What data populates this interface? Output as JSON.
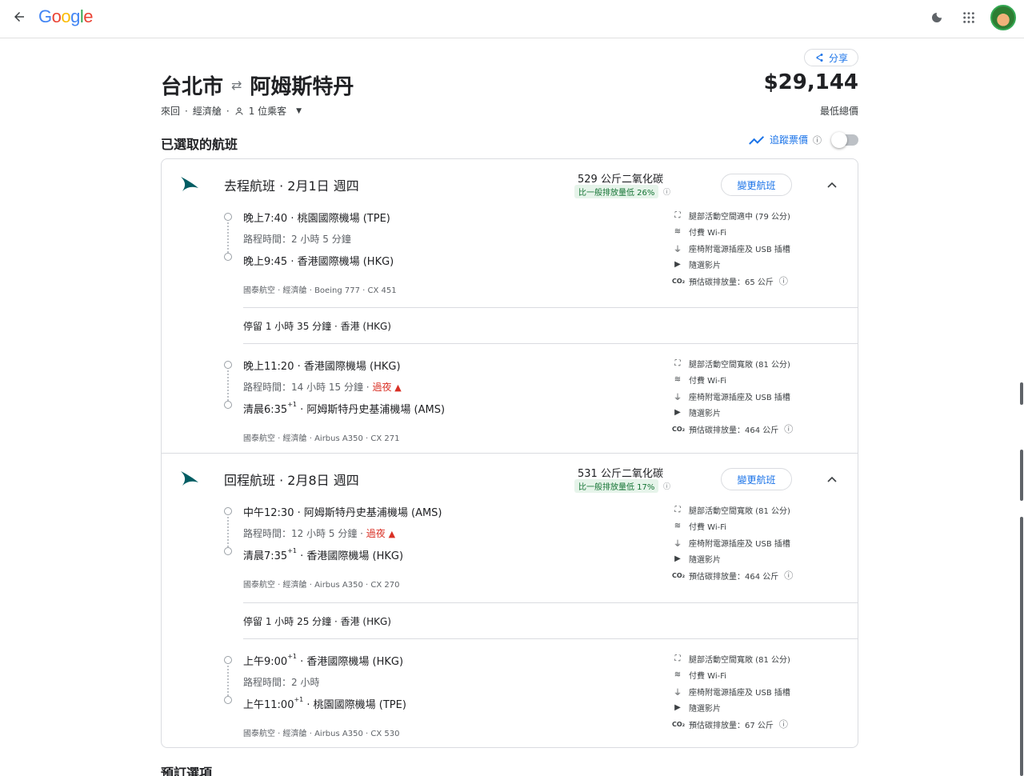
{
  "topbar": {
    "logo_text": "Google",
    "logo_colors": [
      "#4285F4",
      "#EA4335",
      "#FBBC05",
      "#4285F4",
      "#34A853",
      "#EA4335"
    ],
    "icons": [
      "back-arrow-icon",
      "dark-mode-icon",
      "apps-grid-icon",
      "avatar"
    ]
  },
  "header": {
    "share_label": "分享",
    "origin": "台北市",
    "destination": "阿姆斯特丹",
    "trip_type": "來回",
    "cabin": "經濟艙",
    "passengers": "1 位乘客",
    "price": "$29,144",
    "price_label": "最低總價"
  },
  "selected": {
    "title": "已選取的航班",
    "track_label": "追蹤票價",
    "track_enabled": false
  },
  "legs": [
    {
      "title": "去程航班 · 2月1日 週四",
      "co2": "529 公斤二氧化碳",
      "co2_badge": "比一般排放量低 26%",
      "change_label": "變更航班",
      "segments": [
        {
          "depart": "晚上7:40 · 桃園國際機場 (TPE)",
          "duration": "路程時間：2 小時 5 分鐘",
          "overnight": "",
          "arrive": "晚上9:45 · 香港國際機場 (HKG)",
          "arrive_sup": "",
          "meta": "國泰航空 · 經濟艙 · Boeing 777 · CX 451",
          "amenities": [
            "腿部活動空間適中 (79 公分)",
            "付費 Wi-Fi",
            "座椅附電源插座及 USB 插槽",
            "隨選影片",
            "預估碳排放量：65 公斤"
          ]
        },
        {
          "depart": "晚上11:20 · 香港國際機場 (HKG)",
          "duration": "路程時間：14 小時 15 分鐘 · ",
          "overnight": "過夜",
          "arrive_prefix": "清晨6:35",
          "arrive_sup": "+1",
          "arrive": " · 阿姆斯特丹史基浦機場 (AMS)",
          "meta": "國泰航空 · 經濟艙 · Airbus A350 · CX 271",
          "amenities": [
            "腿部活動空間寬敞 (81 公分)",
            "付費 Wi-Fi",
            "座椅附電源插座及 USB 插槽",
            "隨選影片",
            "預估碳排放量：464 公斤"
          ]
        }
      ],
      "layover": "停留 1 小時 35 分鐘 · 香港 (HKG)"
    },
    {
      "title": "回程航班 · 2月8日 週四",
      "co2": "531 公斤二氧化碳",
      "co2_badge": "比一般排放量低 17%",
      "change_label": "變更航班",
      "segments": [
        {
          "depart": "中午12:30 · 阿姆斯特丹史基浦機場 (AMS)",
          "duration": "路程時間：12 小時 5 分鐘 · ",
          "overnight": "過夜",
          "arrive_prefix": "清晨7:35",
          "arrive_sup": "+1",
          "arrive": " · 香港國際機場 (HKG)",
          "meta": "國泰航空 · 經濟艙 · Airbus A350 · CX 270",
          "amenities": [
            "腿部活動空間寬敞 (81 公分)",
            "付費 Wi-Fi",
            "座椅附電源插座及 USB 插槽",
            "隨選影片",
            "預估碳排放量：464 公斤"
          ]
        },
        {
          "depart_prefix": "上午9:00",
          "depart_sup": "+1",
          "depart": " · 香港國際機場 (HKG)",
          "duration": "路程時間：2 小時",
          "overnight": "",
          "arrive_prefix": "上午11:00",
          "arrive_sup": "+1",
          "arrive": " · 桃園國際機場 (TPE)",
          "meta": "國泰航空 · 經濟艙 · Airbus A350 · CX 530",
          "amenities": [
            "腿部活動空間寬敞 (81 公分)",
            "付費 Wi-Fi",
            "座椅附電源插座及 USB 插槽",
            "隨選影片",
            "預估碳排放量：67 公斤"
          ]
        }
      ],
      "layover": "停留 1 小時 25 分鐘 · 香港 (HKG)"
    }
  ],
  "booking_title": "預訂選項",
  "colors": {
    "accent": "#1a73e8",
    "green": "#137333",
    "green_bg": "#e6f4ea",
    "warning": "#d93025",
    "cathay": "#005d63"
  }
}
